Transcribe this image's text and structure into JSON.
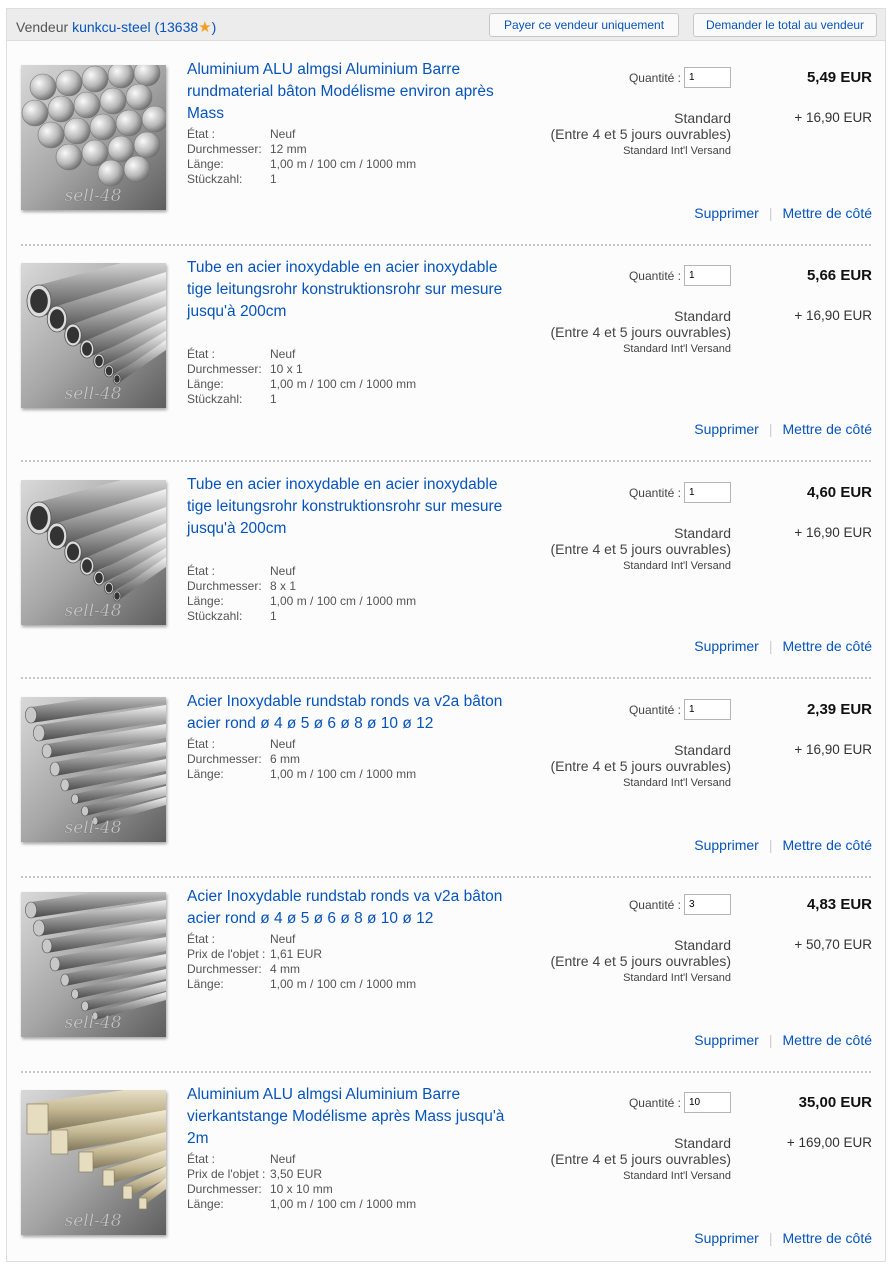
{
  "seller": {
    "label": "Vendeur",
    "name": "kunkcu-steel",
    "score_open": "(13638",
    "score_close": ")",
    "pay_button": "Payer ce vendeur uniquement",
    "total_button": "Demander le total au vendeur"
  },
  "common": {
    "qty_label": "Quantité :",
    "ship_method": "Standard",
    "ship_days": "(Entre 4 et 5 jours ouvrables)",
    "ship_intl": "Standard Int'l Versand",
    "remove": "Supprimer",
    "save": "Mettre de côté",
    "watermark": "sell-48"
  },
  "items": [
    {
      "title": "Aluminium ALU almgsi Aluminium Barre rundmaterial bâton Modélisme environ après Mass",
      "specs": [
        {
          "label": "État :",
          "value": "Neuf"
        },
        {
          "label": "Durchmesser:",
          "value": "12 mm"
        },
        {
          "label": "Länge:",
          "value": "1,00 m / 100 cm / 1000 mm"
        },
        {
          "label": "Stückzahl:",
          "value": "1"
        }
      ],
      "qty": "1",
      "price": "5,49 EUR",
      "ship_cost": "+ 16,90 EUR",
      "image": "round-bars-icon"
    },
    {
      "title": "Tube en acier inoxydable en acier inoxydable tige leitungsrohr konstruktionsrohr sur mesure jusqu'à 200cm",
      "specs": [
        {
          "label": "État :",
          "value": "Neuf"
        },
        {
          "label": "Durchmesser:",
          "value": "10 x 1"
        },
        {
          "label": "Länge:",
          "value": "1,00 m / 100 cm / 1000 mm"
        },
        {
          "label": "Stückzahl:",
          "value": "1"
        }
      ],
      "qty": "1",
      "price": "5,66 EUR",
      "ship_cost": "+ 16,90 EUR",
      "image": "tubes-icon"
    },
    {
      "title": "Tube en acier inoxydable en acier inoxydable tige leitungsrohr konstruktionsrohr sur mesure jusqu'à 200cm",
      "specs": [
        {
          "label": "État :",
          "value": "Neuf"
        },
        {
          "label": "Durchmesser:",
          "value": "8 x 1"
        },
        {
          "label": "Länge:",
          "value": "1,00 m / 100 cm / 1000 mm"
        },
        {
          "label": "Stückzahl:",
          "value": "1"
        }
      ],
      "qty": "1",
      "price": "4,60 EUR",
      "ship_cost": "+ 16,90 EUR",
      "image": "tubes-icon"
    },
    {
      "title": "Acier Inoxydable rundstab ronds va v2a bâton acier rond ø 4 ø 5 ø 6 ø 8 ø 10 ø 12",
      "specs": [
        {
          "label": "État :",
          "value": "Neuf"
        },
        {
          "label": "Durchmesser:",
          "value": "6 mm"
        },
        {
          "label": "Länge:",
          "value": "1,00 m / 100 cm / 1000 mm"
        }
      ],
      "qty": "1",
      "price": "2,39 EUR",
      "ship_cost": "+ 16,90 EUR",
      "image": "steel-rods-icon"
    },
    {
      "title": "Acier Inoxydable rundstab ronds va v2a bâton acier rond ø 4 ø 5 ø 6 ø 8 ø 10 ø 12",
      "specs": [
        {
          "label": "État :",
          "value": "Neuf"
        },
        {
          "label": "Prix de l'objet :",
          "value": "1,61 EUR"
        },
        {
          "label": "Durchmesser:",
          "value": "4 mm"
        },
        {
          "label": "Länge:",
          "value": "1,00 m / 100 cm / 1000 mm"
        }
      ],
      "qty": "3",
      "price": "4,83 EUR",
      "ship_cost": "+ 50,70 EUR",
      "image": "steel-rods-icon"
    },
    {
      "title": "Aluminium ALU almgsi Aluminium Barre vierkantstange Modélisme après Mass jusqu'à 2m",
      "specs": [
        {
          "label": "État :",
          "value": "Neuf"
        },
        {
          "label": "Prix de l'objet :",
          "value": "3,50 EUR"
        },
        {
          "label": "Durchmesser:",
          "value": "10 x 10 mm"
        },
        {
          "label": "Länge:",
          "value": "1,00 m / 100 cm / 1000 mm"
        }
      ],
      "qty": "10",
      "price": "35,00 EUR",
      "ship_cost": "+ 169,00 EUR",
      "image": "square-bars-icon"
    }
  ]
}
